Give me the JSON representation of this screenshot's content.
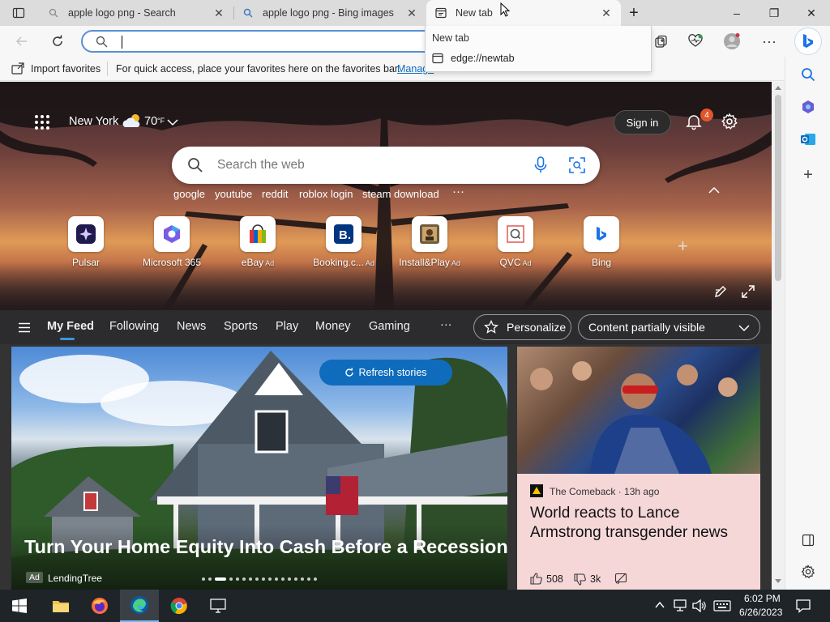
{
  "browser": {
    "tabs": [
      {
        "title": "apple logo png - Search",
        "close": "✕"
      },
      {
        "title": "apple logo png - Bing images",
        "close": "✕"
      },
      {
        "title": "New tab",
        "close": "✕"
      }
    ],
    "new_tab": "+",
    "window": {
      "minimize": "–",
      "maximize": "❐",
      "close": "✕"
    },
    "address_value": "",
    "favorites_bar": {
      "import": "Import favorites",
      "message": "For quick access, place your favorites here on the favorites bar.",
      "link": "Manage"
    },
    "tab_dropdown": {
      "title": "New tab",
      "url": "edge://newtab"
    },
    "colors": {
      "accent": "#0f6cbd",
      "tab_strip": "#dcdcdc"
    }
  },
  "newtab": {
    "location": "New York",
    "temperature": "70",
    "unit": "°F",
    "sign_in": "Sign in",
    "notification_count": "4",
    "search_placeholder": "Search the web",
    "quick_links": [
      "google",
      "youtube",
      "reddit",
      "roblox login",
      "steam download"
    ],
    "more_links": "···",
    "tiles": [
      {
        "label": "Pulsar",
        "ad": ""
      },
      {
        "label": "Microsoft 365",
        "ad": ""
      },
      {
        "label": "eBay",
        "ad": "Ad"
      },
      {
        "label": "Booking.c...",
        "ad": "Ad"
      },
      {
        "label": "Install&Play",
        "ad": "Ad"
      },
      {
        "label": "QVC",
        "ad": "Ad"
      },
      {
        "label": "Bing",
        "ad": ""
      }
    ],
    "feed_tabs": [
      "My Feed",
      "Following",
      "News",
      "Sports",
      "Play",
      "Money",
      "Gaming"
    ],
    "feed_more": "···",
    "personalize": "Personalize",
    "content_visibility": "Content partially visible",
    "refresh": "Refresh stories",
    "main_card": {
      "headline": "Turn Your Home Equity Into Cash Before a Recession",
      "ad_tag": "Ad",
      "sponsor": "LendingTree"
    },
    "side_card": {
      "source": "The Comeback · 13h ago",
      "headline": "World reacts to Lance Armstrong transgender news",
      "likes": "508",
      "dislikes": "3k"
    }
  },
  "taskbar": {
    "time": "6:02 PM",
    "date": "6/26/2023"
  }
}
